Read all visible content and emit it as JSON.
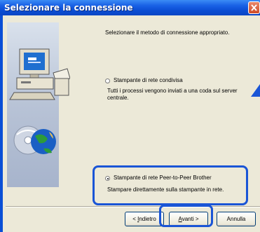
{
  "window": {
    "title": "Selezionare la connessione"
  },
  "main": {
    "instruction": "Selezionare il metodo di connessione appropriato.",
    "options": [
      {
        "label": "Stampante di rete condivisa",
        "description": "Tutti i processi vengono inviati a una coda sul server centrale.",
        "selected": false
      },
      {
        "label": "Stampante di rete Peer-to-Peer Brother",
        "description": "Stampare direttamente sulla stampante in rete.",
        "selected": true
      }
    ]
  },
  "buttons": {
    "back": {
      "prefix": "< ",
      "mnemonic": "I",
      "rest": "ndietro"
    },
    "next": {
      "mnemonic": "A",
      "rest": "vanti >"
    },
    "cancel": "Annulla"
  },
  "colors": {
    "highlight": "#1a55d6",
    "titlebar": "#0a4cd2",
    "dialog_bg": "#ece9d8"
  }
}
